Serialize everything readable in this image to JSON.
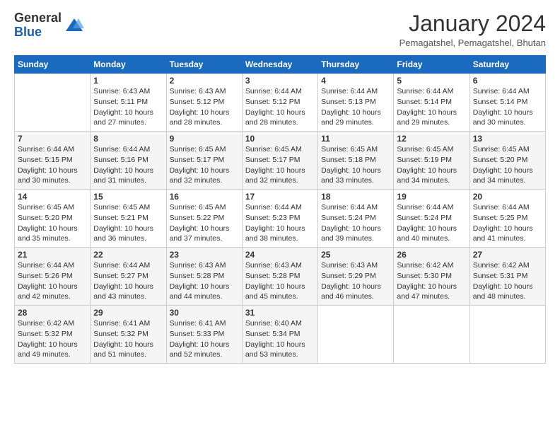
{
  "header": {
    "logo_general": "General",
    "logo_blue": "Blue",
    "month_year": "January 2024",
    "location": "Pemagatshel, Pemagatshel, Bhutan"
  },
  "days_of_week": [
    "Sunday",
    "Monday",
    "Tuesday",
    "Wednesday",
    "Thursday",
    "Friday",
    "Saturday"
  ],
  "weeks": [
    [
      {
        "day": "",
        "info": ""
      },
      {
        "day": "1",
        "info": "Sunrise: 6:43 AM\nSunset: 5:11 PM\nDaylight: 10 hours\nand 27 minutes."
      },
      {
        "day": "2",
        "info": "Sunrise: 6:43 AM\nSunset: 5:12 PM\nDaylight: 10 hours\nand 28 minutes."
      },
      {
        "day": "3",
        "info": "Sunrise: 6:44 AM\nSunset: 5:12 PM\nDaylight: 10 hours\nand 28 minutes."
      },
      {
        "day": "4",
        "info": "Sunrise: 6:44 AM\nSunset: 5:13 PM\nDaylight: 10 hours\nand 29 minutes."
      },
      {
        "day": "5",
        "info": "Sunrise: 6:44 AM\nSunset: 5:14 PM\nDaylight: 10 hours\nand 29 minutes."
      },
      {
        "day": "6",
        "info": "Sunrise: 6:44 AM\nSunset: 5:14 PM\nDaylight: 10 hours\nand 30 minutes."
      }
    ],
    [
      {
        "day": "7",
        "info": "Sunrise: 6:44 AM\nSunset: 5:15 PM\nDaylight: 10 hours\nand 30 minutes."
      },
      {
        "day": "8",
        "info": "Sunrise: 6:44 AM\nSunset: 5:16 PM\nDaylight: 10 hours\nand 31 minutes."
      },
      {
        "day": "9",
        "info": "Sunrise: 6:45 AM\nSunset: 5:17 PM\nDaylight: 10 hours\nand 32 minutes."
      },
      {
        "day": "10",
        "info": "Sunrise: 6:45 AM\nSunset: 5:17 PM\nDaylight: 10 hours\nand 32 minutes."
      },
      {
        "day": "11",
        "info": "Sunrise: 6:45 AM\nSunset: 5:18 PM\nDaylight: 10 hours\nand 33 minutes."
      },
      {
        "day": "12",
        "info": "Sunrise: 6:45 AM\nSunset: 5:19 PM\nDaylight: 10 hours\nand 34 minutes."
      },
      {
        "day": "13",
        "info": "Sunrise: 6:45 AM\nSunset: 5:20 PM\nDaylight: 10 hours\nand 34 minutes."
      }
    ],
    [
      {
        "day": "14",
        "info": "Sunrise: 6:45 AM\nSunset: 5:20 PM\nDaylight: 10 hours\nand 35 minutes."
      },
      {
        "day": "15",
        "info": "Sunrise: 6:45 AM\nSunset: 5:21 PM\nDaylight: 10 hours\nand 36 minutes."
      },
      {
        "day": "16",
        "info": "Sunrise: 6:45 AM\nSunset: 5:22 PM\nDaylight: 10 hours\nand 37 minutes."
      },
      {
        "day": "17",
        "info": "Sunrise: 6:44 AM\nSunset: 5:23 PM\nDaylight: 10 hours\nand 38 minutes."
      },
      {
        "day": "18",
        "info": "Sunrise: 6:44 AM\nSunset: 5:24 PM\nDaylight: 10 hours\nand 39 minutes."
      },
      {
        "day": "19",
        "info": "Sunrise: 6:44 AM\nSunset: 5:24 PM\nDaylight: 10 hours\nand 40 minutes."
      },
      {
        "day": "20",
        "info": "Sunrise: 6:44 AM\nSunset: 5:25 PM\nDaylight: 10 hours\nand 41 minutes."
      }
    ],
    [
      {
        "day": "21",
        "info": "Sunrise: 6:44 AM\nSunset: 5:26 PM\nDaylight: 10 hours\nand 42 minutes."
      },
      {
        "day": "22",
        "info": "Sunrise: 6:44 AM\nSunset: 5:27 PM\nDaylight: 10 hours\nand 43 minutes."
      },
      {
        "day": "23",
        "info": "Sunrise: 6:43 AM\nSunset: 5:28 PM\nDaylight: 10 hours\nand 44 minutes."
      },
      {
        "day": "24",
        "info": "Sunrise: 6:43 AM\nSunset: 5:28 PM\nDaylight: 10 hours\nand 45 minutes."
      },
      {
        "day": "25",
        "info": "Sunrise: 6:43 AM\nSunset: 5:29 PM\nDaylight: 10 hours\nand 46 minutes."
      },
      {
        "day": "26",
        "info": "Sunrise: 6:42 AM\nSunset: 5:30 PM\nDaylight: 10 hours\nand 47 minutes."
      },
      {
        "day": "27",
        "info": "Sunrise: 6:42 AM\nSunset: 5:31 PM\nDaylight: 10 hours\nand 48 minutes."
      }
    ],
    [
      {
        "day": "28",
        "info": "Sunrise: 6:42 AM\nSunset: 5:32 PM\nDaylight: 10 hours\nand 49 minutes."
      },
      {
        "day": "29",
        "info": "Sunrise: 6:41 AM\nSunset: 5:32 PM\nDaylight: 10 hours\nand 51 minutes."
      },
      {
        "day": "30",
        "info": "Sunrise: 6:41 AM\nSunset: 5:33 PM\nDaylight: 10 hours\nand 52 minutes."
      },
      {
        "day": "31",
        "info": "Sunrise: 6:40 AM\nSunset: 5:34 PM\nDaylight: 10 hours\nand 53 minutes."
      },
      {
        "day": "",
        "info": ""
      },
      {
        "day": "",
        "info": ""
      },
      {
        "day": "",
        "info": ""
      }
    ]
  ]
}
